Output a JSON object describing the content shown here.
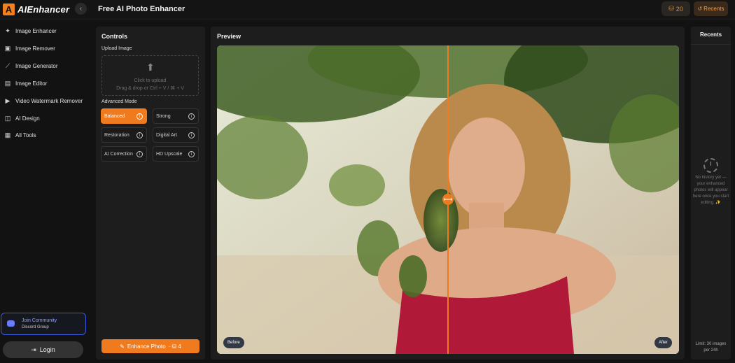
{
  "app": {
    "logo_letter": "A",
    "logo_text": "AIEnhancer",
    "collapse_glyph": "‹",
    "title": "Free AI Photo Enhancer",
    "credits": "20",
    "recents_button": "Recents"
  },
  "sidebar": {
    "items": [
      {
        "label": "Image Enhancer",
        "icon": "sparkle-icon"
      },
      {
        "label": "Image Remover",
        "icon": "image-remove-icon"
      },
      {
        "label": "Image Generator",
        "icon": "magic-wand-icon"
      },
      {
        "label": "Image Editor",
        "icon": "image-edit-icon"
      },
      {
        "label": "Video Watermark Remover",
        "icon": "video-icon"
      },
      {
        "label": "AI Design",
        "icon": "design-icon"
      },
      {
        "label": "All Tools",
        "icon": "grid-icon"
      }
    ],
    "community_title": "Join Community",
    "community_subtitle": "Discord Group",
    "login_label": "Login"
  },
  "controls": {
    "title": "Controls",
    "upload_label": "Upload Image",
    "upload_line1": "Click to upload",
    "upload_line2": "Drag & drop or Ctrl + V / ⌘ + V",
    "advanced_label": "Advanced Mode",
    "modes": [
      "Balanced",
      "Strong",
      "Restoration",
      "Digital Art",
      "AI Correction",
      "HD Upscale"
    ],
    "active_mode": "Balanced",
    "enhance_label": "Enhance Photo",
    "enhance_cost": "· ⛁ 4"
  },
  "preview": {
    "title": "Preview",
    "before_label": "Before",
    "after_label": "After",
    "slider_position": 0.5
  },
  "recents": {
    "title": "Recents",
    "empty_text": "No history yet — your enhanced photos will appear here once you start editing. ✨",
    "limit_text": "Limit: 30 images per 24h"
  },
  "colors": {
    "accent": "#f07a1e",
    "discord": "#3b5be0"
  }
}
